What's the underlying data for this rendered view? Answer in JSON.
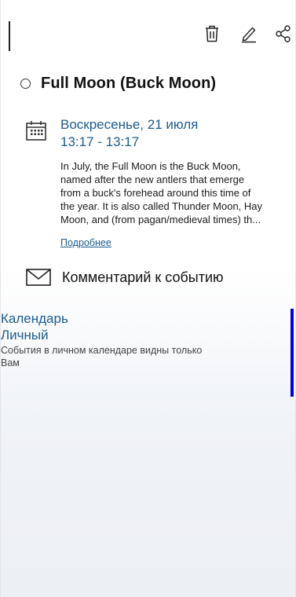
{
  "toolbar": {
    "delete_icon": "trash-icon",
    "edit_icon": "pencil-icon",
    "share_icon": "share-icon"
  },
  "event": {
    "title": "Full Moon (Buck Moon)",
    "date": "Воскресенье, 21 июля",
    "time": "13:17 - 13:17",
    "description_lines": [
      "In July, the Full Moon is the Buck Moon,",
      "named after the new antlers that emerge",
      "from a buck's forehead around this time of",
      "the year. It is also called Thunder Moon, Hay",
      "Moon, and (from pagan/medieval times) th..."
    ],
    "more_link": "Подробнее",
    "comment_label": "Комментарий к событию"
  },
  "calendar": {
    "heading": "Календарь",
    "name": "Личный",
    "note_lines": [
      "События в личном календаре видны только",
      "Вам"
    ],
    "color": "#0000dd"
  },
  "colors": {
    "accent": "#1d5b91",
    "calendar_color": "#0000dd"
  }
}
